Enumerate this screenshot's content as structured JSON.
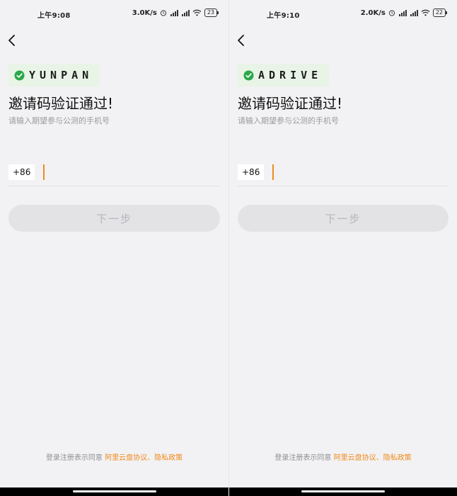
{
  "screens": [
    {
      "time": "上午9:08",
      "net_speed": "3.0K/s",
      "battery": "23",
      "brand": "YUNPAN",
      "title": "邀请码验证通过!",
      "subtitle": "请输入期望参与公测的手机号",
      "country_code": "+86",
      "phone_value": "",
      "phone_placeholder": "",
      "next_label": "下一步",
      "agreement_prefix": "登录注册表示同意 ",
      "agreement_link1": "阿里云盘协议",
      "agreement_sep": "、",
      "agreement_link2": "隐私政策"
    },
    {
      "time": "上午9:10",
      "net_speed": "2.0K/s",
      "battery": "22",
      "brand": "ADRIVE",
      "title": "邀请码验证通过!",
      "subtitle": "请输入期望参与公测的手机号",
      "country_code": "+86",
      "phone_value": "",
      "phone_placeholder": "",
      "next_label": "下一步",
      "agreement_prefix": "登录注册表示同意 ",
      "agreement_link1": "阿里云盘协议",
      "agreement_sep": "、",
      "agreement_link2": "隐私政策"
    }
  ],
  "colors": {
    "background": "#f2f2f4",
    "accent": "#f08a1c",
    "brand_green": "#2aa84a",
    "brand_bg": "#e8f4e6",
    "button_disabled_bg": "#e3e3e6",
    "button_disabled_text": "#b5b5bb"
  },
  "icons": {
    "back": "chevron-left-icon",
    "verified": "check-circle-icon",
    "alarm": "alarm-icon",
    "signal": "signal-icon",
    "wifi": "wifi-icon",
    "battery": "battery-icon"
  }
}
